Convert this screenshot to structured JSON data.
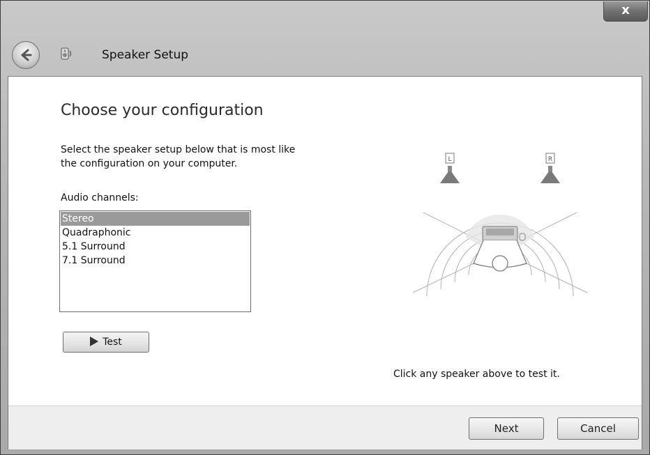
{
  "window": {
    "title": "Speaker Setup",
    "close_label": "x"
  },
  "page": {
    "heading": "Choose your configuration",
    "description": "Select the speaker setup below that is most like\nthe configuration on your computer.",
    "channels_label": "Audio channels:",
    "channels": [
      "Stereo",
      "Quadraphonic",
      "5.1 Surround",
      "7.1 Surround"
    ],
    "selected_channel": "Stereo",
    "test_label": "Test",
    "hint": "Click any speaker above to test it."
  },
  "diagram": {
    "left_speaker_label": "L",
    "right_speaker_label": "R"
  },
  "footer": {
    "next_label": "Next",
    "cancel_label": "Cancel"
  }
}
